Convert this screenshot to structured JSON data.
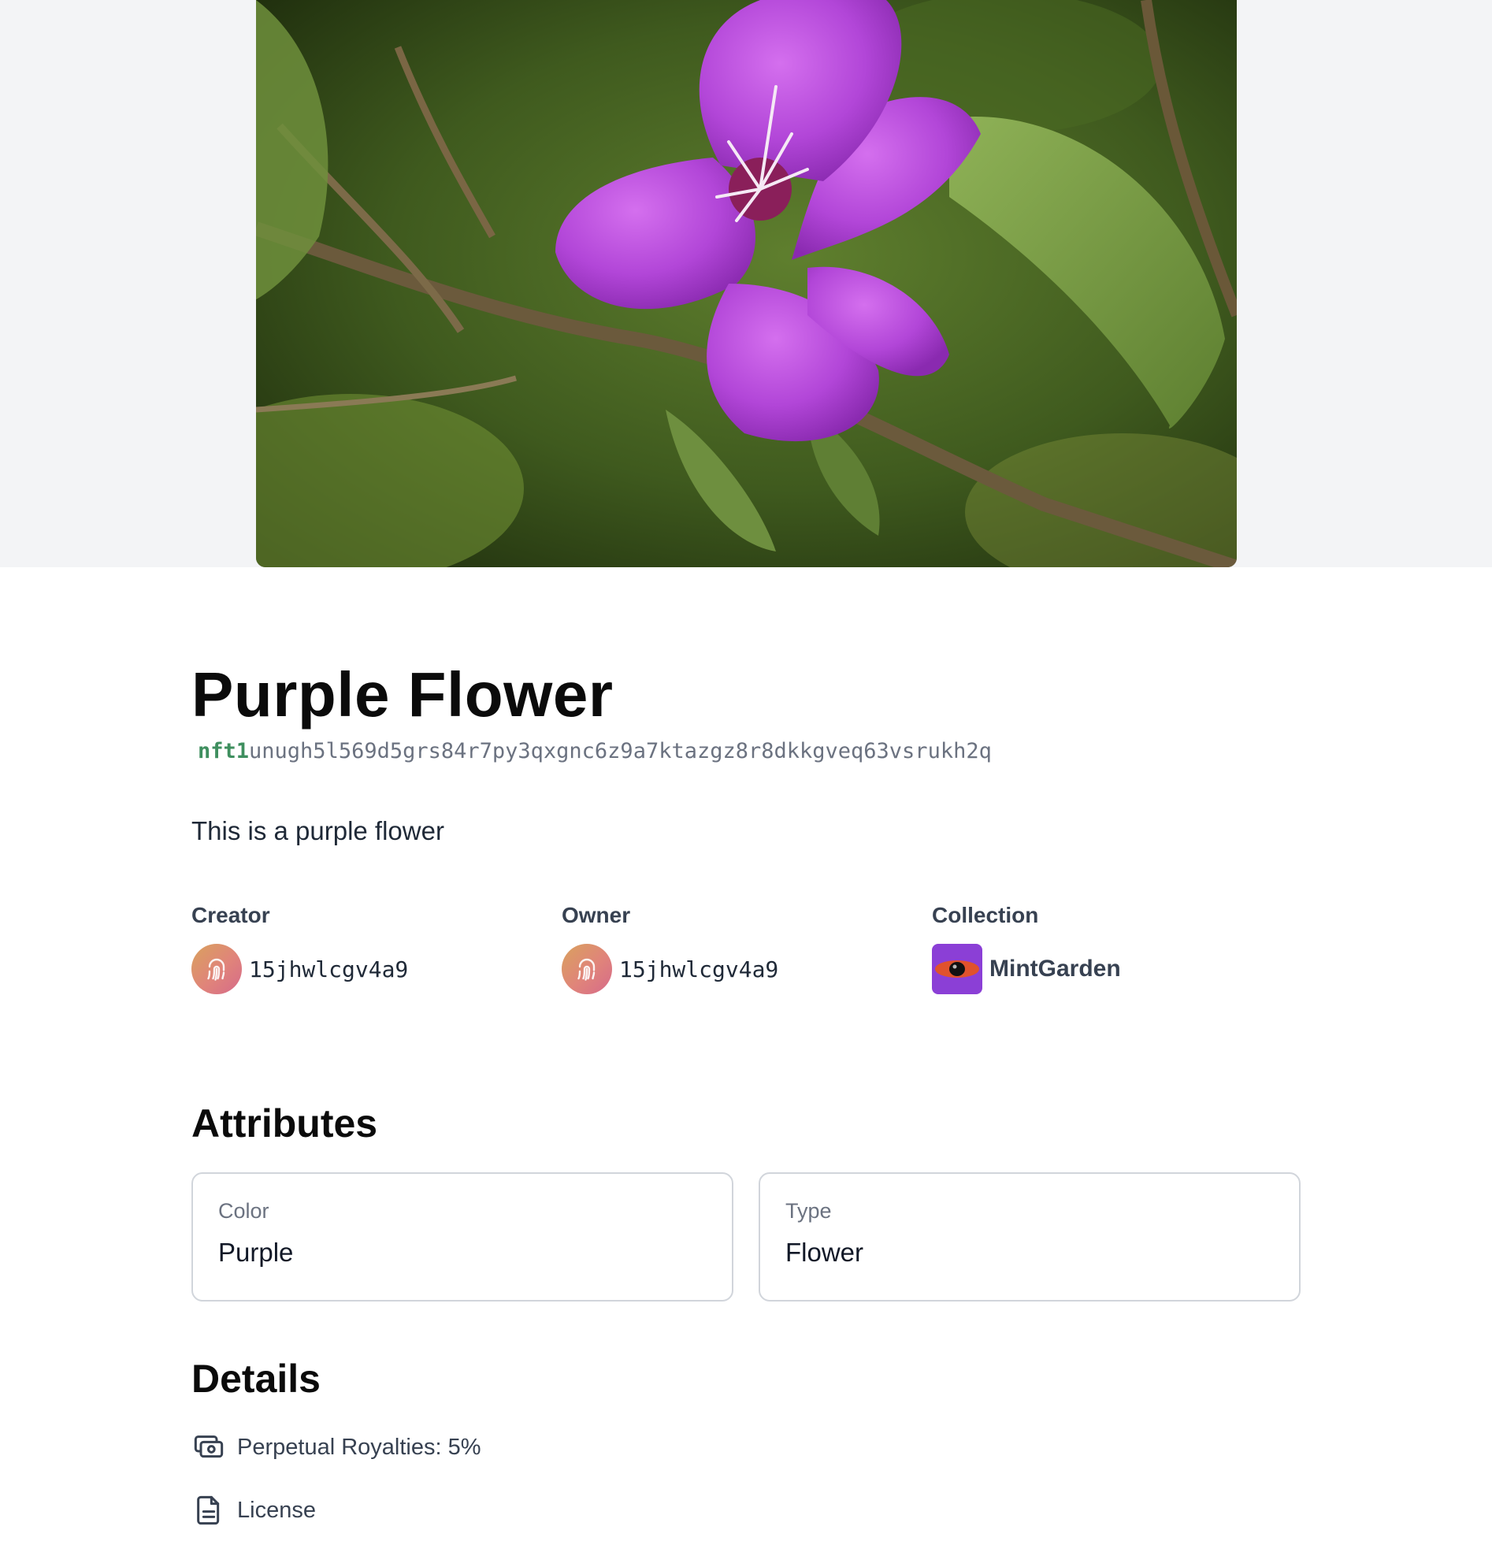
{
  "nft": {
    "name": "Purple Flower",
    "id_prefix": "nft1",
    "id_rest": "unugh5l569d5grs84r7py3qxgnc6z9a7ktazgz8r8dkkgveq63vsrukh2q",
    "description": "This is a purple flower"
  },
  "meta": {
    "creator": {
      "label": "Creator",
      "value": "15jhwlcgv4a9",
      "icon": "fingerprint-icon"
    },
    "owner": {
      "label": "Owner",
      "value": "15jhwlcgv4a9",
      "icon": "fingerprint-icon"
    },
    "collection": {
      "label": "Collection",
      "value": "MintGarden",
      "icon": "eye-icon"
    }
  },
  "attributes": {
    "title": "Attributes",
    "items": [
      {
        "trait": "Color",
        "value": "Purple"
      },
      {
        "trait": "Type",
        "value": "Flower"
      }
    ]
  },
  "details": {
    "title": "Details",
    "royalties": {
      "text": "Perpetual Royalties: 5%",
      "icon": "royalties-icon"
    },
    "license": {
      "text": "License",
      "icon": "document-icon"
    }
  },
  "colors": {
    "accent_green": "#3f8f5f",
    "collection_purple": "#8b3fd6",
    "hero_background": "#f3f4f6"
  }
}
